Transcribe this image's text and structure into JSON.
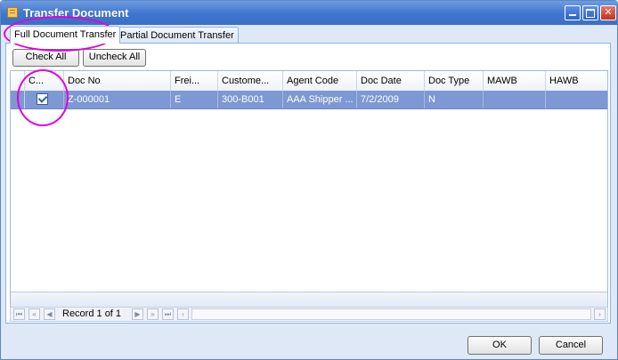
{
  "window": {
    "title": "Transfer Document",
    "buttons": [
      "minimize",
      "maximize",
      "close"
    ]
  },
  "tabs": [
    {
      "label": "Full Document Transfer",
      "active": true
    },
    {
      "label": "Partial Document Transfer",
      "active": false
    }
  ],
  "toolbar": {
    "check_all_label": "Check All",
    "uncheck_all_label": "Uncheck All"
  },
  "grid": {
    "columns": [
      "C...",
      "Doc No",
      "Frei...",
      "Custome...",
      "Agent Code",
      "Doc Date",
      "Doc Type",
      "MAWB",
      "HAWB"
    ],
    "rows": [
      {
        "checked": true,
        "doc_no": "Z-000001",
        "freight": "E",
        "customer": "300-B001",
        "agent_code": "AAA Shipper ...",
        "doc_date": "7/2/2009",
        "doc_type": "N",
        "mawb": "",
        "hawb": ""
      }
    ],
    "selected_row_color": "#7d98d3"
  },
  "navigator": {
    "record_text": "Record 1 of 1",
    "icons": [
      "first-icon",
      "prev-page-icon",
      "prev-icon",
      "next-icon",
      "next-page-icon",
      "last-icon",
      "scroll-left-icon",
      "scroll-right-icon"
    ]
  },
  "footer": {
    "ok_label": "OK",
    "cancel_label": "Cancel"
  },
  "annotation_color": "#e000e0"
}
